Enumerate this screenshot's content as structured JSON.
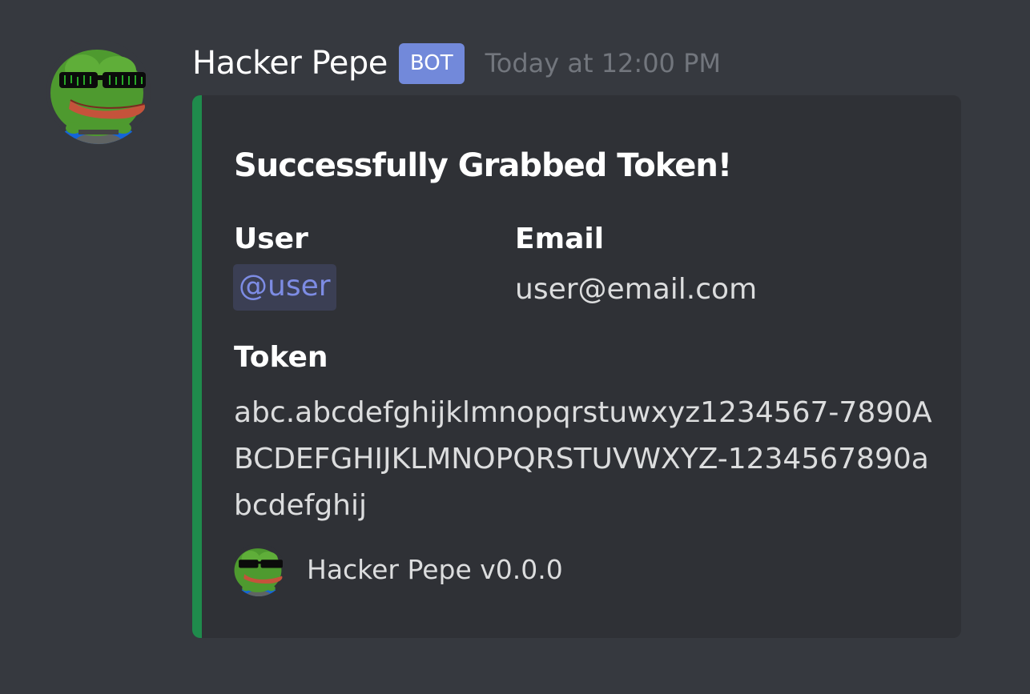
{
  "colors": {
    "background": "#36393f",
    "embed_background": "#2f3136",
    "embed_accent": "#1f8b4c",
    "badge": "#7289da",
    "mention_text": "#7d8ce4",
    "mention_background": "#3b3f54"
  },
  "message": {
    "author": "Hacker Pepe",
    "badge": "BOT",
    "timestamp": "Today at 12:00 PM",
    "avatar_icon": "hacker-pepe-avatar"
  },
  "embed": {
    "title": "Successfully Grabbed Token!",
    "fields": {
      "user": {
        "name": "User",
        "value": "@user"
      },
      "email": {
        "name": "Email",
        "value": "user@email.com"
      },
      "token": {
        "name": "Token",
        "value": "abc.abcdefghijklmnopqrstuwxyz1234567-7890ABCDEFGHIJKLMNOPQRSTUVWXYZ-1234567890abcdefghij"
      }
    },
    "footer": {
      "text": "Hacker Pepe v0.0.0",
      "icon": "hacker-pepe-avatar"
    }
  }
}
